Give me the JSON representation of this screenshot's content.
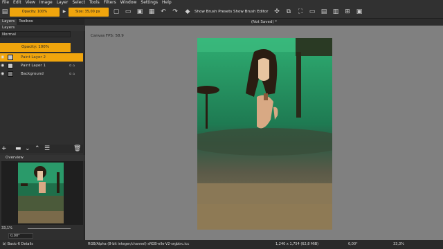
{
  "menu": [
    "File",
    "Edit",
    "View",
    "Image",
    "Layer",
    "Select",
    "Tools",
    "Filters",
    "Window",
    "Settings",
    "Help"
  ],
  "toolbar": {
    "opacity": "Opacity: 100%",
    "size": "Size: 35,00 px",
    "brush_presets": "Show Brush Presets",
    "brush_editor": "Show Brush Editor"
  },
  "left": {
    "tabs": [
      "Layers",
      "Toolbox"
    ],
    "panel_title": "Layers",
    "blend_mode": "Normal",
    "opacity": "Opacity: 100%",
    "layers": [
      {
        "name": "Paint Layer 2",
        "selected": true
      },
      {
        "name": "Paint Layer 1",
        "selected": false
      },
      {
        "name": "Background",
        "selected": false
      }
    ],
    "overview_title": "Overview",
    "zoom": "33,1%",
    "rotation": "0,00°"
  },
  "canvas": {
    "doc_title": "(Not Saved)  *",
    "fps": "Canvas FPS: 58.9"
  },
  "status": {
    "brush": "b) Basic-6 Details",
    "color_info": "RGB/Alpha (8-bit integer/channel)  sRGB-elle-V2-srgbtrc.icc",
    "dimensions": "1,240 x 1,754 (62,8 MiB)",
    "rotation": "0,00°",
    "zoom": "33,3%"
  },
  "colors": {
    "accent": "#f0a50d",
    "canvas_bg": "#808080",
    "panel_bg": "#2f2f2f"
  }
}
